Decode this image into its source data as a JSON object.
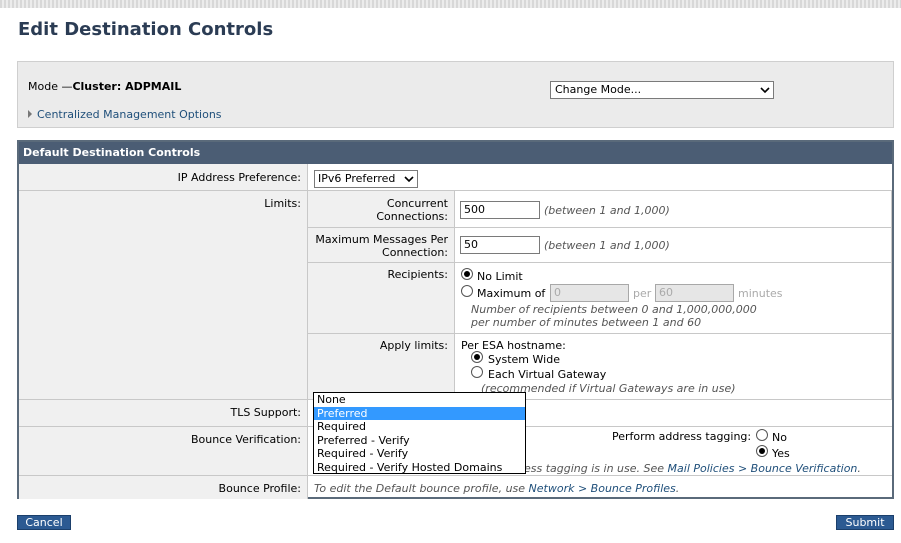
{
  "page": {
    "title": "Edit Destination Controls"
  },
  "mode": {
    "prefix": "Mode —",
    "value": "Cluster: ADPMAIL",
    "change_mode_select": "Change Mode...",
    "centralized_link": "Centralized Management Options"
  },
  "section": {
    "header": "Default Destination Controls"
  },
  "ip_pref": {
    "label": "IP Address Preference:",
    "value": "IPv6 Preferred"
  },
  "limits": {
    "label": "Limits:",
    "concurrent": {
      "label_line1": "Concurrent",
      "label_line2": "Connections:",
      "value": "500",
      "hint": "(between 1 and 1,000)"
    },
    "max_messages": {
      "label_line1": "Maximum Messages Per",
      "label_line2": "Connection:",
      "value": "50",
      "hint": "(between 1 and 1,000)"
    },
    "recipients": {
      "label": "Recipients:",
      "no_limit": "No Limit",
      "maximum_of": "Maximum of",
      "max_value": "0",
      "per": "per",
      "minutes_value": "60",
      "minutes": "minutes",
      "hint_line1": "Number of recipients between 0 and 1,000,000,000",
      "hint_line2": "per number of minutes between 1 and 60"
    },
    "apply": {
      "label": "Apply limits:",
      "per_esa": "Per ESA hostname:",
      "system_wide": "System Wide",
      "each_vg": "Each Virtual Gateway",
      "hint": "(recommended if Virtual Gateways are in use)"
    }
  },
  "tls": {
    "label": "TLS Support:",
    "options": [
      "None",
      "Preferred",
      "Required",
      "Preferred - Verify",
      "Required - Verify",
      "Required - Verify Hosted Domains"
    ],
    "selected_index": 1
  },
  "bounce_verification": {
    "label": "Bounce Verification:",
    "perform_tagging": "Perform address tagging:",
    "no": "No",
    "yes": "Yes",
    "note_visible": "ess tagging is in use. See ",
    "note_link": "Mail Policies > Bounce Verification",
    "note_end": "."
  },
  "bounce_profile": {
    "label": "Bounce Profile:",
    "text": "To edit the Default bounce profile, use ",
    "link": "Network > Bounce Profiles",
    "end": "."
  },
  "buttons": {
    "cancel": "Cancel",
    "submit": "Submit"
  },
  "colors": {
    "header_bg": "#4b5d74",
    "title": "#2b3c54",
    "button": "#2c5a92",
    "dropdown_highlight": "#3399ff"
  }
}
